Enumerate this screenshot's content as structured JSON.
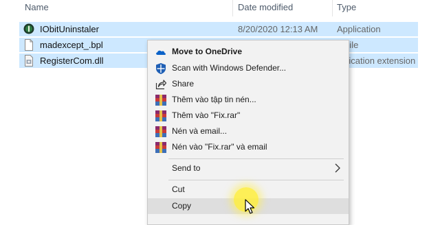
{
  "header": {
    "name": "Name",
    "date_modified": "Date modified",
    "type": "Type"
  },
  "files": [
    {
      "name": "IObitUninstaler",
      "date": "8/20/2020 12:13 AM",
      "type": "Application",
      "icon": "iobit-app-icon",
      "selected": true
    },
    {
      "name": "madexcept_.bpl",
      "date": "",
      "type": "L File",
      "icon": "file-icon",
      "selected": true
    },
    {
      "name": "RegisterCom.dll",
      "date": "",
      "type": "pplication extension",
      "icon": "dll-file-icon",
      "selected": true
    }
  ],
  "context_menu": {
    "items": [
      {
        "label": "Move to OneDrive",
        "icon": "onedrive-cloud-icon",
        "bold": true
      },
      {
        "label": "Scan with Windows Defender...",
        "icon": "windows-defender-icon"
      },
      {
        "label": "Share",
        "icon": "share-icon"
      },
      {
        "label": "Thêm vào tập tin nén...",
        "icon": "winrar-icon"
      },
      {
        "label": "Thêm vào \"Fix.rar\"",
        "icon": "winrar-icon"
      },
      {
        "label": "Nén và email...",
        "icon": "winrar-icon"
      },
      {
        "label": "Nén vào \"Fix.rar\" và email",
        "icon": "winrar-icon"
      },
      {
        "label": "Send to",
        "icon": "",
        "submenu": true
      },
      {
        "label": "Cut",
        "icon": ""
      },
      {
        "label": "Copy",
        "icon": "",
        "hover": true
      }
    ]
  },
  "colors": {
    "selection": "#cde8ff",
    "menu_bg": "#f2f2f2",
    "menu_hover": "#dedede",
    "onedrive": "#0a62c8",
    "defender": "#1f5fb5",
    "cursor_highlight": "#ffee3c"
  }
}
